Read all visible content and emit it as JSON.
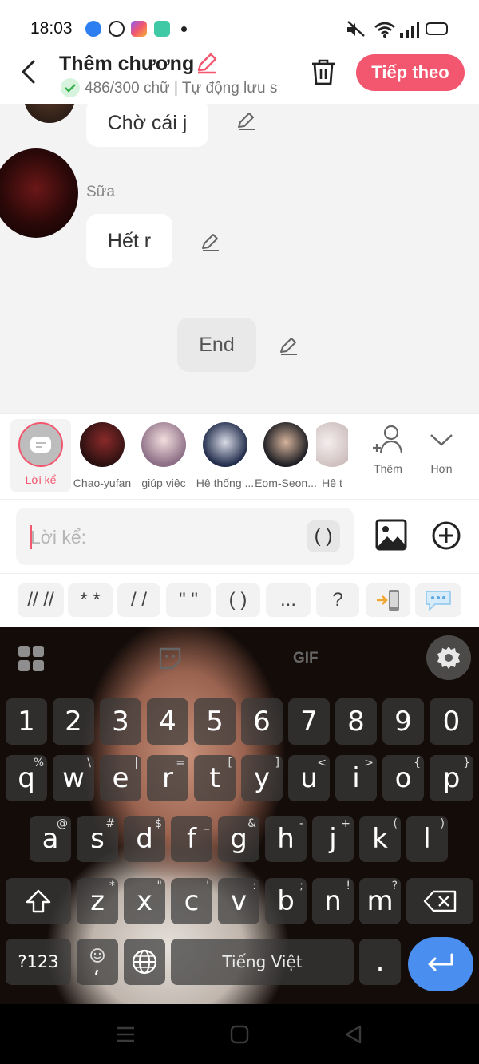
{
  "status_bar": {
    "time": "18:03"
  },
  "header": {
    "title": "Thêm chương",
    "subtitle": "486/300 chữ | Tự động lưu s",
    "next_label": "Tiếp theo"
  },
  "chat": {
    "messages": [
      {
        "text": "Chờ cái j"
      },
      {
        "sender": "Sữa",
        "text": "Hết r"
      },
      {
        "text": "End"
      }
    ]
  },
  "characters": [
    {
      "name": "Lời kể"
    },
    {
      "name": "Chao-yufan"
    },
    {
      "name": "giúp việc"
    },
    {
      "name": "Hệ thống ..."
    },
    {
      "name": "Eom-Seon..."
    },
    {
      "name": "Hệ t"
    }
  ],
  "char_actions": {
    "add_label": "Thêm",
    "more_label": "Hơn"
  },
  "input": {
    "placeholder": "Lời kể:",
    "paren": "( )"
  },
  "quick_symbols": [
    "// //",
    "* *",
    "/ /",
    "\" \"",
    "( )",
    "...",
    "?"
  ],
  "keyboard": {
    "gif": "GIF",
    "row1": [
      "1",
      "2",
      "3",
      "4",
      "5",
      "6",
      "7",
      "8",
      "9",
      "0"
    ],
    "row2": [
      [
        "q",
        "%"
      ],
      [
        "w",
        "\\"
      ],
      [
        "e",
        "|"
      ],
      [
        "r",
        "="
      ],
      [
        "t",
        "["
      ],
      [
        "y",
        "]"
      ],
      [
        "u",
        "<"
      ],
      [
        "i",
        ">"
      ],
      [
        "o",
        "{"
      ],
      [
        "p",
        "}"
      ]
    ],
    "row3": [
      [
        "a",
        "@"
      ],
      [
        "s",
        "#"
      ],
      [
        "d",
        "$"
      ],
      [
        "f",
        "_"
      ],
      [
        "g",
        "&"
      ],
      [
        "h",
        "-"
      ],
      [
        "j",
        "+"
      ],
      [
        "k",
        "("
      ],
      [
        "l",
        ")"
      ]
    ],
    "row4": [
      [
        "z",
        "*"
      ],
      [
        "x",
        "\""
      ],
      [
        "c",
        "'"
      ],
      [
        "v",
        ":"
      ],
      [
        "b",
        ";"
      ],
      [
        "n",
        "!"
      ],
      [
        "m",
        "?"
      ]
    ],
    "symbols_label": "?123",
    "space_label": "Tiếng Việt",
    "period": "."
  },
  "colors": {
    "accent": "#f2576f",
    "enter": "#4a8ff0"
  }
}
